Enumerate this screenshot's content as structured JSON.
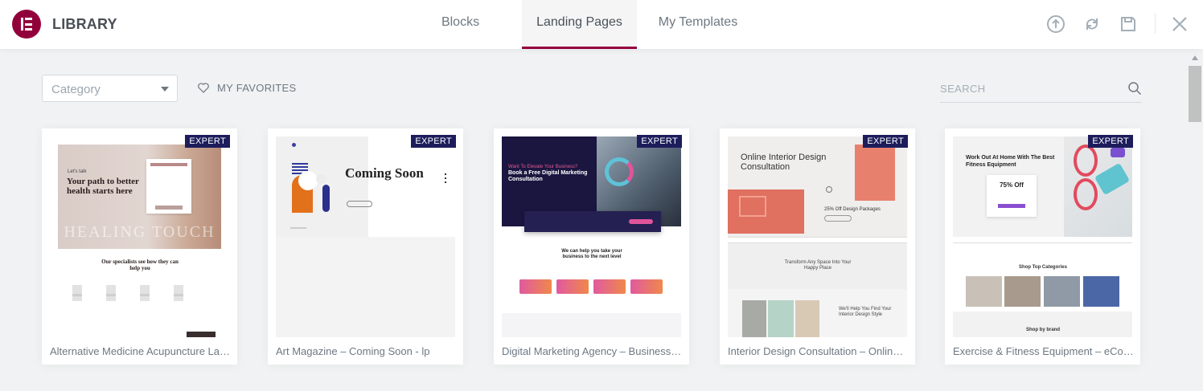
{
  "header": {
    "app_title": "LIBRARY",
    "tabs": [
      {
        "label": "Blocks",
        "active": false
      },
      {
        "label": "Landing Pages",
        "active": true
      },
      {
        "label": "My Templates",
        "active": false
      }
    ],
    "icons": [
      "upload-icon",
      "sync-icon",
      "save-icon",
      "close-icon"
    ]
  },
  "toolbar": {
    "category_placeholder": "Category",
    "favorites_label": "MY FAVORITES",
    "search_placeholder": "SEARCH"
  },
  "cards": [
    {
      "title": "Alternative Medicine Acupuncture Landing Page",
      "badge": "EXPERT",
      "thumb": {
        "kicker": "Let's talk",
        "headline": "Your path to better health starts here",
        "watermark": "HEALING TOUCH",
        "sub": "Our specialists see how they can help you"
      }
    },
    {
      "title": "Art Magazine – Coming Soon - lp",
      "badge": "EXPERT",
      "thumb": {
        "headline": "Coming Soon"
      }
    },
    {
      "title": "Digital Marketing Agency – Business Landing Page",
      "badge": "EXPERT",
      "thumb": {
        "kicker": "Want To Elevate Your Business?",
        "headline": "Book a Free Digital Marketing Consultation",
        "sub": "We can help you take your business to the next level"
      }
    },
    {
      "title": "Interior Design Consultation – Online Landing Page",
      "badge": "EXPERT",
      "thumb": {
        "headline": "Online Interior Design Consultation",
        "offer": "25% Off Design Packages",
        "sub": "Transform Any Space Into Your Happy Place",
        "sub2": "We'll Help You Find Your Interior Design Style"
      }
    },
    {
      "title": "Exercise & Fitness Equipment – eCommerce Landing Page",
      "badge": "EXPERT",
      "thumb": {
        "headline": "Work Out At Home With The Best Fitness Equipment",
        "offer": "75% Off",
        "sub": "Shop Top Categories",
        "sub2": "Shop by brand"
      }
    }
  ],
  "colors": {
    "brand": "#92003b",
    "badge_bg": "#1d1d5c",
    "active_tab_underline": "#93003c"
  }
}
